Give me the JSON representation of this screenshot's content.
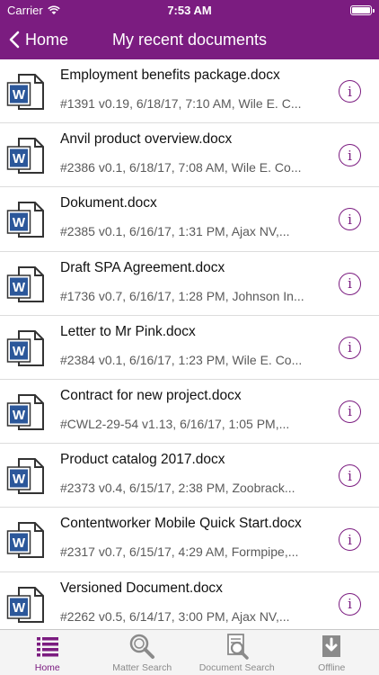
{
  "status": {
    "carrier": "Carrier",
    "time": "7:53 AM"
  },
  "nav": {
    "back_label": "Home",
    "title": "My recent documents"
  },
  "documents": [
    {
      "name": "Employment benefits package.docx",
      "meta": "#1391 v0.19, 6/18/17, 7:10 AM,  Wile E. C..."
    },
    {
      "name": "Anvil product overview.docx",
      "meta": "#2386 v0.1, 6/18/17, 7:08 AM,  Wile E. Co..."
    },
    {
      "name": "Dokument.docx",
      "meta": "#2385 v0.1, 6/16/17, 1:31 PM,  Ajax NV,..."
    },
    {
      "name": "Draft SPA Agreement.docx",
      "meta": "#1736 v0.7, 6/16/17, 1:28 PM,  Johnson In..."
    },
    {
      "name": "Letter to Mr Pink.docx",
      "meta": "#2384 v0.1, 6/16/17, 1:23 PM,  Wile E. Co..."
    },
    {
      "name": "Contract for new project.docx",
      "meta": "#CWL2-29-54 v1.13, 6/16/17, 1:05 PM,..."
    },
    {
      "name": "Product catalog 2017.docx",
      "meta": "#2373 v0.4, 6/15/17, 2:38 PM,  Zoobrack..."
    },
    {
      "name": "Contentworker Mobile Quick Start.docx",
      "meta": "#2317 v0.7, 6/15/17, 4:29 AM,  Formpipe,..."
    },
    {
      "name": "Versioned Document.docx",
      "meta": "#2262 v0.5, 6/14/17, 3:00 PM,  Ajax NV,..."
    }
  ],
  "tabs": [
    {
      "label": "Home",
      "icon": "list-icon",
      "active": true
    },
    {
      "label": "Matter Search",
      "icon": "search-icon",
      "active": false
    },
    {
      "label": "Document Search",
      "icon": "document-search-icon",
      "active": false
    },
    {
      "label": "Offline",
      "icon": "download-icon",
      "active": false
    }
  ],
  "colors": {
    "accent": "#7b1c80",
    "word_blue": "#2b579a"
  }
}
